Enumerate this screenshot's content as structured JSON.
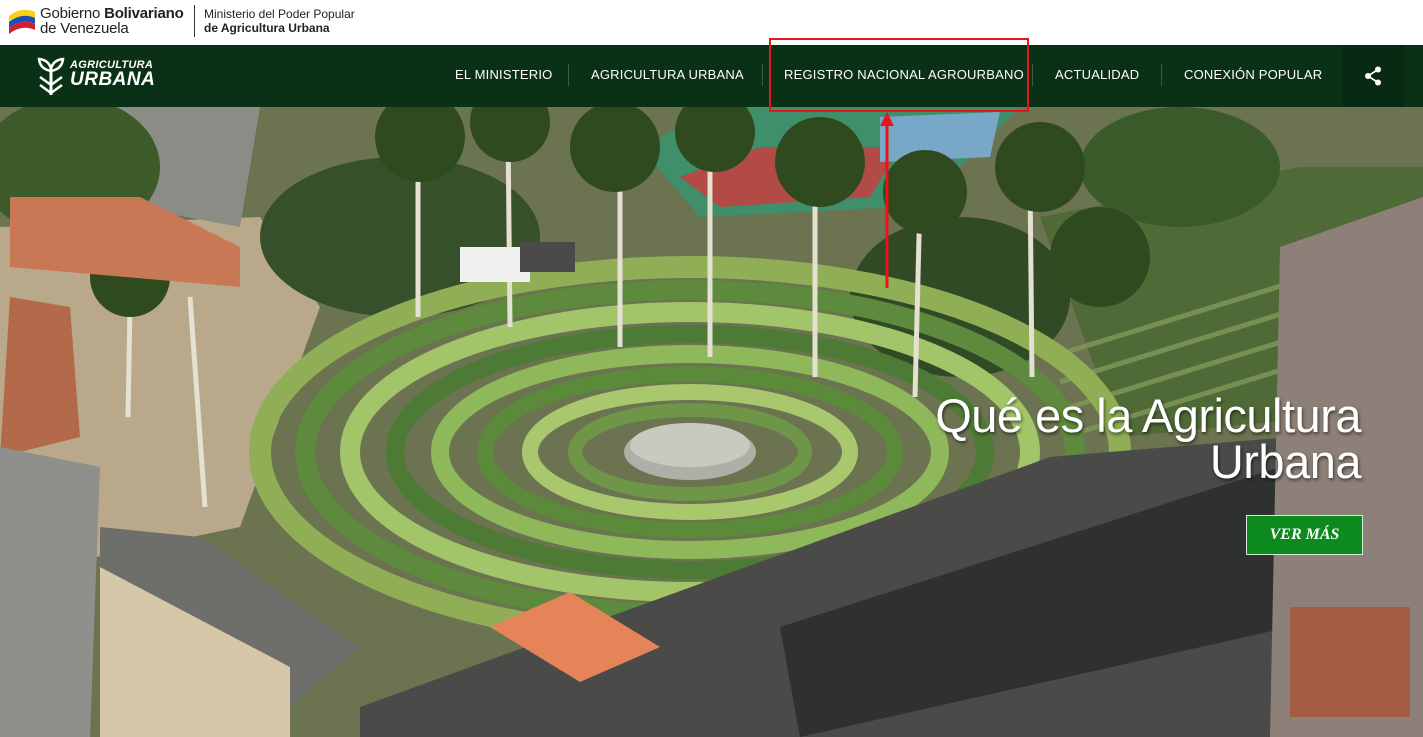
{
  "gov_header": {
    "line1_prefix": "Gobierno ",
    "line1_bold": "Bolivariano",
    "line2": "de Venezuela",
    "ministry_line1": "Ministerio del Poder Popular",
    "ministry_line2": "de Agricultura Urbana"
  },
  "logo": {
    "line1": "AGRICULTURA",
    "line2": "URBANA"
  },
  "nav": {
    "items": [
      {
        "label": "EL MINISTERIO"
      },
      {
        "label": "AGRICULTURA URBANA"
      },
      {
        "label": "REGISTRO NACIONAL AGROURBANO"
      },
      {
        "label": "ACTUALIDAD"
      },
      {
        "label": "CONEXIÓN POPULAR"
      }
    ],
    "share_icon": "share-icon"
  },
  "hero": {
    "headline_line1": "Qué es la Agricultura",
    "headline_line2": "Urbana",
    "cta_label": "VER MÁS"
  },
  "colors": {
    "nav_bg": "#0a3115",
    "cta_bg": "#0d8a1e",
    "annotation": "#e8141b"
  }
}
